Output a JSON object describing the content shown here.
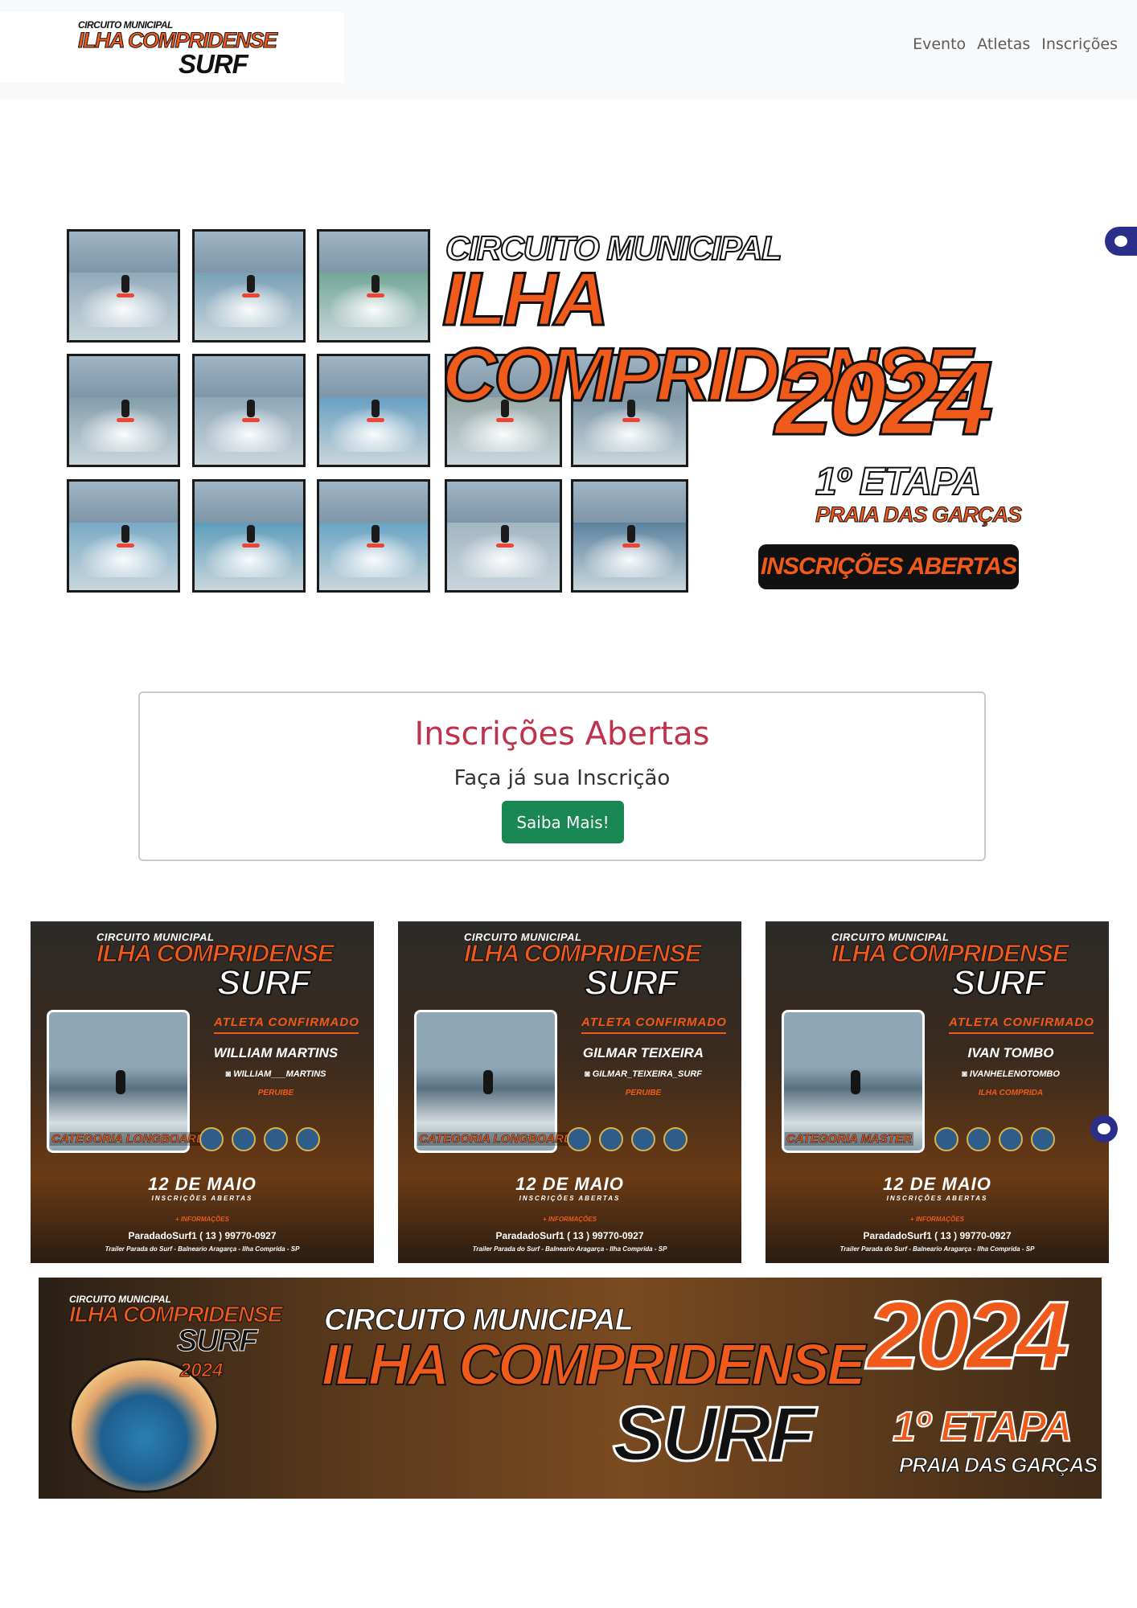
{
  "navbar": {
    "brand": {
      "line1": "CIRCUITO MUNICIPAL",
      "line2": "ILHA COMPRIDENSE",
      "line3": "SURF"
    },
    "links": [
      "Evento",
      "Atletas",
      "Inscrições"
    ]
  },
  "hero": {
    "title_small": "CIRCUITO MUNICIPAL",
    "title_big": "ILHA COMPRIDENSE",
    "year": "2024",
    "stage": "1º ETAPA",
    "location": "PRAIA DAS GARÇAS",
    "badge": "INSCRIÇÕES ABERTAS",
    "photo_count": 14
  },
  "cta": {
    "title": "Inscrições Abertas",
    "subtitle": "Faça já sua Inscrição",
    "button": "Saiba Mais!"
  },
  "athletes": [
    {
      "circuit": "CIRCUITO MUNICIPAL",
      "name_line": "ILHA COMPRIDENSE",
      "surf": "SURF",
      "confirmed": "ATLETA CONFIRMADO",
      "athlete": "WILLIAM MARTINS",
      "instagram": "WILLIAM___MARTINS",
      "city": "PERUIBE",
      "category": "CATEGORIA LONGBOARD",
      "date": "12 DE MAIO",
      "status": "INSCRIÇÕES ABERTAS",
      "info": "+ INFORMAÇÕES",
      "contact": "ParadadoSurf1   ( 13 ) 99770-0927",
      "address": "Trailer Parada do Surf - Balneario Aragarça - Ilha Comprida - SP"
    },
    {
      "circuit": "CIRCUITO MUNICIPAL",
      "name_line": "ILHA COMPRIDENSE",
      "surf": "SURF",
      "confirmed": "ATLETA CONFIRMADO",
      "athlete": "GILMAR TEIXEIRA",
      "instagram": "GILMAR_TEIXEIRA_SURF",
      "city": "PERUIBE",
      "category": "CATEGORIA LONGBOARD",
      "date": "12 DE MAIO",
      "status": "INSCRIÇÕES ABERTAS",
      "info": "+ INFORMAÇÕES",
      "contact": "ParadadoSurf1   ( 13 ) 99770-0927",
      "address": "Trailer Parada do Surf - Balneario Aragarça - Ilha Comprida - SP"
    },
    {
      "circuit": "CIRCUITO MUNICIPAL",
      "name_line": "ILHA COMPRIDENSE",
      "surf": "SURF",
      "confirmed": "ATLETA CONFIRMADO",
      "athlete": "IVAN TOMBO",
      "instagram": "IVANHELENOTOMBO",
      "city": "ILHA COMPRIDA",
      "category": "CATEGORIA MASTER",
      "date": "12 DE MAIO",
      "status": "INSCRIÇÕES ABERTAS",
      "info": "+ INFORMAÇÕES",
      "contact": "ParadadoSurf1   ( 13 ) 99770-0927",
      "address": "Trailer Parada do Surf - Balneario Aragarça - Ilha Comprida - SP"
    }
  ],
  "banner": {
    "logo_line1": "CIRCUITO MUNICIPAL",
    "logo_line2": "ILHA COMPRIDENSE",
    "logo_line3": "SURF",
    "logo_year": "2024",
    "title_small": "CIRCUITO MUNICIPAL",
    "title_big": "ILHA COMPRIDENSE",
    "title_surf": "SURF",
    "year": "2024",
    "stage": "1º ETAPA",
    "location": "PRAIA DAS GARÇAS"
  },
  "colors": {
    "brand_orange": "#f05a1a",
    "cta_title": "#c0314a",
    "cta_button": "#198754",
    "bot_widget": "#2b2f8a"
  },
  "icons": [
    "discord-bot-icon",
    "instagram-icon",
    "phone-icon"
  ]
}
